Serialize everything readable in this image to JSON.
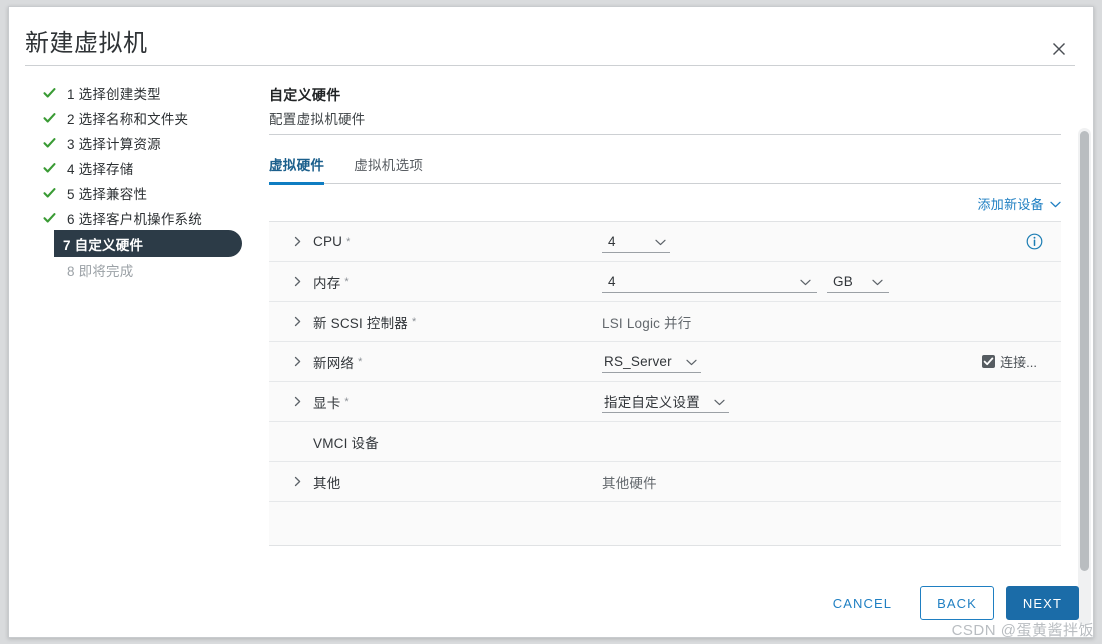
{
  "dialog": {
    "title": "新建虚拟机",
    "close_icon": "close-icon"
  },
  "sidebar": {
    "steps": [
      {
        "num": "1",
        "label": "1 选择创建类型",
        "state": "done"
      },
      {
        "num": "2",
        "label": "2 选择名称和文件夹",
        "state": "done"
      },
      {
        "num": "3",
        "label": "3 选择计算资源",
        "state": "done"
      },
      {
        "num": "4",
        "label": "4 选择存储",
        "state": "done"
      },
      {
        "num": "5",
        "label": "5 选择兼容性",
        "state": "done"
      },
      {
        "num": "6",
        "label": "6 选择客户机操作系统",
        "state": "done"
      },
      {
        "num": "7",
        "label": "7 自定义硬件",
        "state": "active"
      },
      {
        "num": "8",
        "label": "8 即将完成",
        "state": "pending"
      }
    ]
  },
  "main": {
    "title": "自定义硬件",
    "subtitle": "配置虚拟机硬件",
    "tabs": [
      {
        "label": "虚拟硬件",
        "active": true
      },
      {
        "label": "虚拟机选项",
        "active": false
      }
    ],
    "add_device_label": "添加新设备",
    "add_device_chevron": "⌄",
    "rows": [
      {
        "name": "CPU",
        "required": "*",
        "expandable": true,
        "control": "select",
        "value": "4",
        "info_icon": true
      },
      {
        "name": "内存",
        "required": "*",
        "expandable": true,
        "control": "select-unit",
        "value": "4",
        "unit": "GB"
      },
      {
        "name": "新 SCSI 控制器",
        "required": "*",
        "expandable": true,
        "control": "text",
        "value": "LSI Logic 并行"
      },
      {
        "name": "新网络",
        "required": "*",
        "expandable": true,
        "control": "select-auto",
        "value": "RS_Server",
        "checkbox_label": "连接...",
        "checkbox_checked": true
      },
      {
        "name": "显卡",
        "required": "*",
        "expandable": true,
        "control": "select-auto",
        "value": "指定自定义设置"
      },
      {
        "name": "VMCI 设备",
        "required": "",
        "expandable": false,
        "control": "none",
        "value": ""
      },
      {
        "name": "其他",
        "required": "",
        "expandable": true,
        "control": "text",
        "value": "其他硬件"
      }
    ]
  },
  "footer": {
    "cancel_label": "CANCEL",
    "back_label": "BACK",
    "next_label": "NEXT"
  },
  "watermark": "CSDN @蛋黄酱拌饭",
  "colors": {
    "accent": "#1f7fc2",
    "primary_button": "#1b6ca8",
    "active_step_bg": "#2c3b47",
    "check_green": "#3a9b35",
    "info_blue": "#1c7db3"
  }
}
